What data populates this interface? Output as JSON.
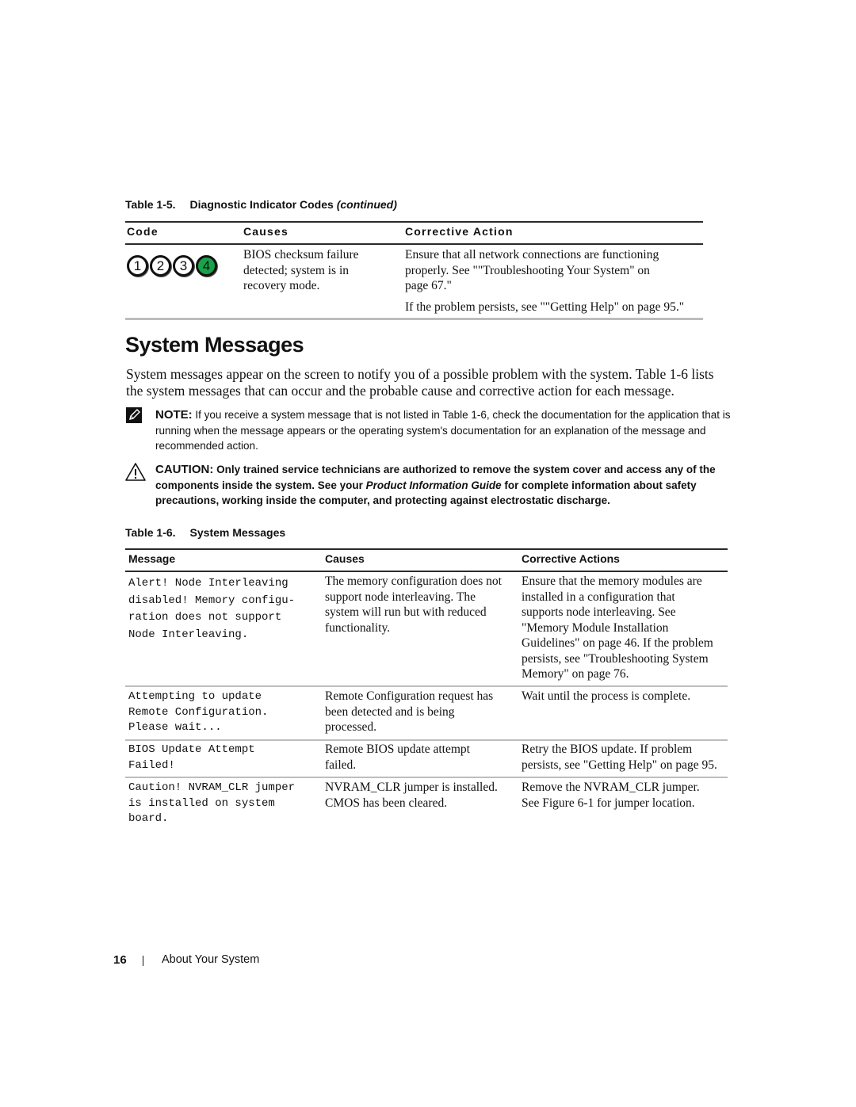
{
  "table_1_5": {
    "caption_number": "Table 1-5.",
    "caption_title": "Diagnostic Indicator Codes",
    "caption_suffix": "(continued)",
    "headers": [
      "Code",
      "Causes",
      "Corrective Action"
    ],
    "rows": [
      {
        "code_leds": [
          {
            "label": "1",
            "state": "off"
          },
          {
            "label": "2",
            "state": "off"
          },
          {
            "label": "3",
            "state": "off"
          },
          {
            "label": "4",
            "state": "on"
          }
        ],
        "causes": [
          "BIOS checksum failure",
          "detected; system is in",
          "recovery mode."
        ],
        "action_lines": [
          "Ensure that all network connections are functioning",
          "properly. See \"\"Troubleshooting Your System\" on",
          "page 67.\""
        ],
        "action_extra": "If the problem persists, see \"\"Getting Help\" on page 95.\""
      }
    ],
    "led_on_color": "#1aa24a"
  },
  "section": {
    "heading": "System Messages",
    "intro_lines": [
      "System messages appear on the screen to notify you of a possible problem with the system. Table 1-6 lists",
      "the system messages that can occur and the probable cause and corrective action for each message."
    ]
  },
  "note": {
    "icon": "pencil-note-icon",
    "label": "NOTE:",
    "text": " If you receive a system message that is not listed in Table 1-6, check the documentation for the application that is running when the message appears or the operating system's documentation for an explanation of the message and recommended action."
  },
  "caution": {
    "icon": "warning-triangle-icon",
    "label": "CAUTION:",
    "text_before": " Only trained service technicians are authorized to remove the system cover and access any of the components inside the system. See your ",
    "text_italic": "Product Information Guide",
    "text_after": " for complete information about safety precautions, working inside the computer, and protecting against electrostatic discharge."
  },
  "table_1_6": {
    "caption_number": "Table 1-6.",
    "caption_title": "System Messages",
    "headers": [
      "Message",
      "Causes",
      "Corrective Actions"
    ],
    "rows": [
      {
        "message": "Alert! Node Interleaving\ndisabled! Memory configu-\nration does not support\nNode Interleaving.",
        "causes": [
          "The memory configuration does not",
          "support node interleaving.  The",
          "system will run but with reduced",
          "functionality."
        ],
        "actions": [
          "Ensure that the memory modules are",
          "installed in a configuration that",
          "supports node interleaving. See",
          "\"Memory Module Installation",
          "Guidelines\" on page 46. If the problem",
          "persists, see \"Troubleshooting System",
          "Memory\" on page 76."
        ]
      },
      {
        "message": "Attempting to update\nRemote Configuration.\nPlease wait...",
        "causes": [
          "Remote Configuration request has",
          "been detected and is being",
          "processed."
        ],
        "actions": [
          "Wait until the process is complete."
        ]
      },
      {
        "message": "BIOS Update Attempt\nFailed!",
        "causes": [
          "Remote BIOS update attempt",
          "failed."
        ],
        "actions": [
          "Retry the BIOS update. If problem",
          "persists, see \"Getting Help\" on page 95."
        ]
      },
      {
        "message": "Caution! NVRAM_CLR jumper\nis installed on system\nboard.",
        "causes": [
          "NVRAM_CLR jumper is installed.",
          "CMOS has been cleared."
        ],
        "actions": [
          "Remove the NVRAM_CLR jumper.",
          "See Figure 6-1 for jumper location."
        ]
      }
    ]
  },
  "footer": {
    "page_number": "16",
    "separator": "|",
    "chapter_title": "About Your System"
  }
}
